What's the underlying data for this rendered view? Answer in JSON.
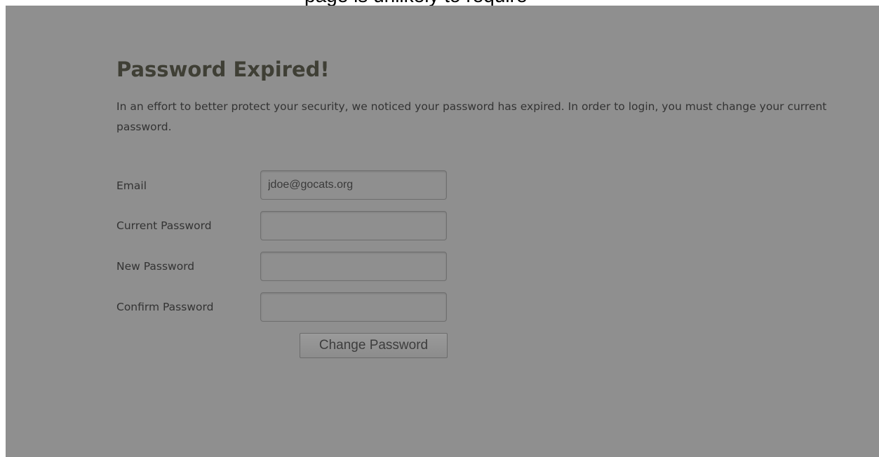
{
  "form": {
    "title": "Password Expired!",
    "description": "In an effort to better protect your security, we noticed your password has expired. In order to login, you must change your current password.",
    "fields": [
      {
        "label": "Email",
        "value": "jdoe@gocats.org"
      },
      {
        "label": "Current Password",
        "value": ""
      },
      {
        "label": "New Password",
        "value": ""
      },
      {
        "label": "Confirm Password",
        "value": ""
      }
    ],
    "submit_label": "Change Password"
  },
  "colors": {
    "overlay_panel": "#8f8f8f",
    "title_text": "#3f3f35",
    "body_text": "#333333"
  }
}
